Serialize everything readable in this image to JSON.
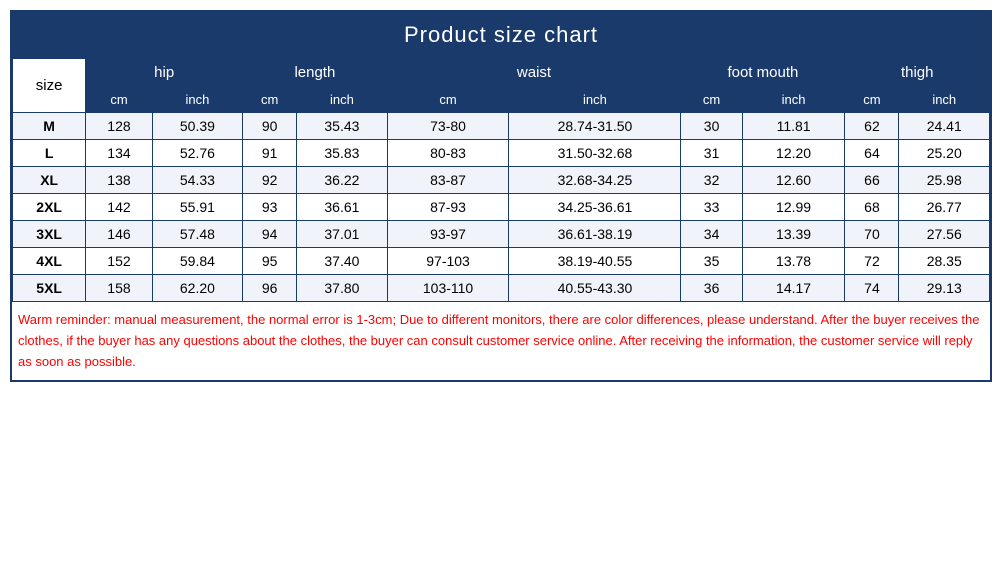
{
  "title": "Product size chart",
  "headers": {
    "size": "size",
    "hip": "hip",
    "length": "length",
    "waist": "waist",
    "foot_mouth": "foot mouth",
    "thigh": "thigh",
    "cm": "cm",
    "inch": "inch"
  },
  "rows": [
    {
      "size": "M",
      "hip_cm": "128",
      "hip_inch": "50.39",
      "len_cm": "90",
      "len_inch": "35.43",
      "waist_cm": "73-80",
      "waist_inch": "28.74-31.50",
      "foot_cm": "30",
      "foot_inch": "11.81",
      "thigh_cm": "62",
      "thigh_inch": "24.41"
    },
    {
      "size": "L",
      "hip_cm": "134",
      "hip_inch": "52.76",
      "len_cm": "91",
      "len_inch": "35.83",
      "waist_cm": "80-83",
      "waist_inch": "31.50-32.68",
      "foot_cm": "31",
      "foot_inch": "12.20",
      "thigh_cm": "64",
      "thigh_inch": "25.20"
    },
    {
      "size": "XL",
      "hip_cm": "138",
      "hip_inch": "54.33",
      "len_cm": "92",
      "len_inch": "36.22",
      "waist_cm": "83-87",
      "waist_inch": "32.68-34.25",
      "foot_cm": "32",
      "foot_inch": "12.60",
      "thigh_cm": "66",
      "thigh_inch": "25.98"
    },
    {
      "size": "2XL",
      "hip_cm": "142",
      "hip_inch": "55.91",
      "len_cm": "93",
      "len_inch": "36.61",
      "waist_cm": "87-93",
      "waist_inch": "34.25-36.61",
      "foot_cm": "33",
      "foot_inch": "12.99",
      "thigh_cm": "68",
      "thigh_inch": "26.77"
    },
    {
      "size": "3XL",
      "hip_cm": "146",
      "hip_inch": "57.48",
      "len_cm": "94",
      "len_inch": "37.01",
      "waist_cm": "93-97",
      "waist_inch": "36.61-38.19",
      "foot_cm": "34",
      "foot_inch": "13.39",
      "thigh_cm": "70",
      "thigh_inch": "27.56"
    },
    {
      "size": "4XL",
      "hip_cm": "152",
      "hip_inch": "59.84",
      "len_cm": "95",
      "len_inch": "37.40",
      "waist_cm": "97-103",
      "waist_inch": "38.19-40.55",
      "foot_cm": "35",
      "foot_inch": "13.78",
      "thigh_cm": "72",
      "thigh_inch": "28.35"
    },
    {
      "size": "5XL",
      "hip_cm": "158",
      "hip_inch": "62.20",
      "len_cm": "96",
      "len_inch": "37.80",
      "waist_cm": "103-110",
      "waist_inch": "40.55-43.30",
      "foot_cm": "36",
      "foot_inch": "14.17",
      "thigh_cm": "74",
      "thigh_inch": "29.13"
    }
  ],
  "footer": "Warm reminder: manual measurement, the normal error is 1-3cm;\nDue to different monitors, there are color differences, please understand.\nAfter the buyer receives the clothes, if the buyer has any questions about the\nclothes, the buyer can consult customer service online. After receiving the\ninformation, the customer service will reply as soon as possible."
}
